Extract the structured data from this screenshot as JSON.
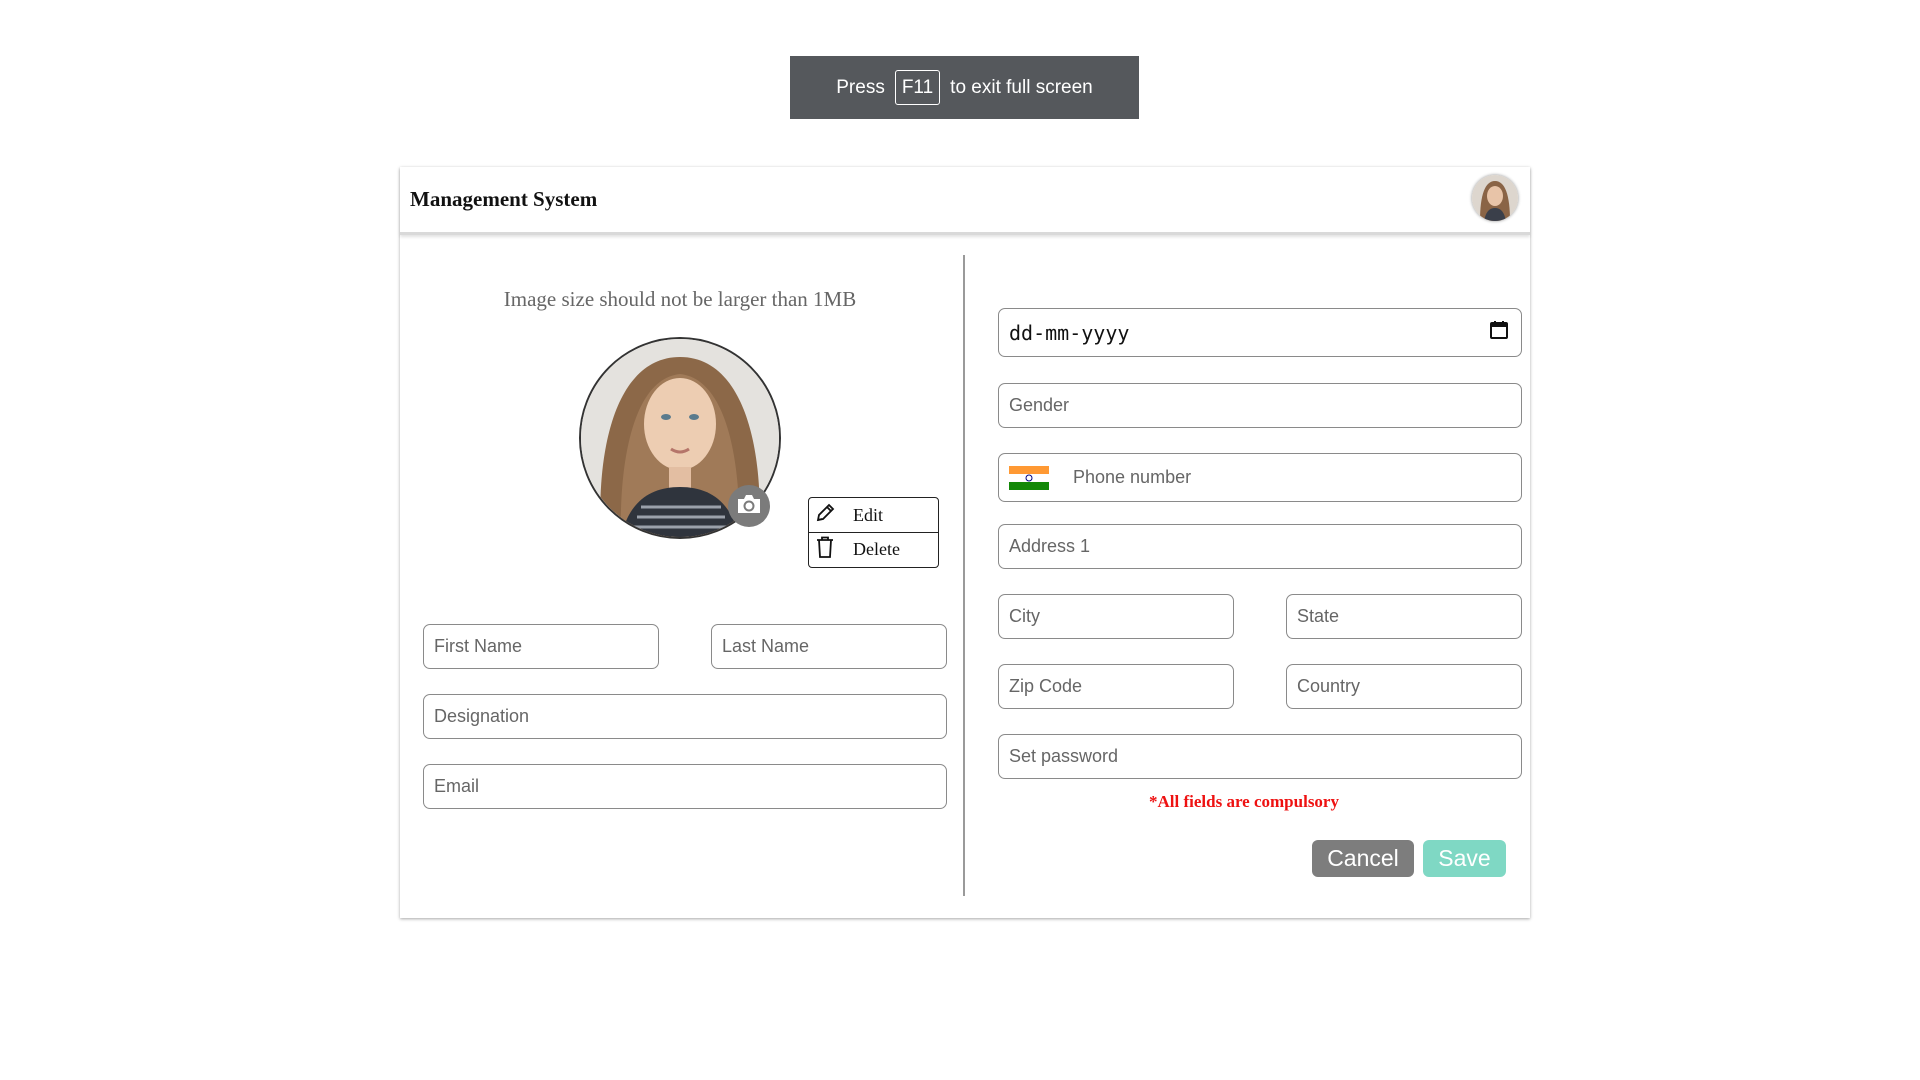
{
  "toast": {
    "press": "Press",
    "key": "F11",
    "rest": "to exit full screen"
  },
  "app": {
    "title": "Management System"
  },
  "upload": {
    "hint": "Image size should not be larger than 1MB"
  },
  "image_menu": {
    "edit": "Edit",
    "delete": "Delete"
  },
  "left_form": {
    "first_name": "First Name",
    "last_name": "Last Name",
    "designation": "Designation",
    "email": "Email"
  },
  "right_form": {
    "date_placeholder": "dd-mm-yyyy",
    "gender": "Gender",
    "phone": "Phone number",
    "address1": "Address 1",
    "city": "City",
    "state": "State",
    "zip": "Zip Code",
    "country": "Country",
    "password": "Set password"
  },
  "notice": {
    "required": "*All fields are compulsory"
  },
  "actions": {
    "cancel": "Cancel",
    "save": "Save"
  },
  "colors": {
    "cancel": "#7d7d7d",
    "save": "#7fd8c4",
    "required": "#ee1111",
    "toast_bg": "#55585c"
  },
  "icons": [
    "calendar-icon",
    "india-flag-icon",
    "camera-icon",
    "pencil-icon",
    "trash-icon"
  ]
}
